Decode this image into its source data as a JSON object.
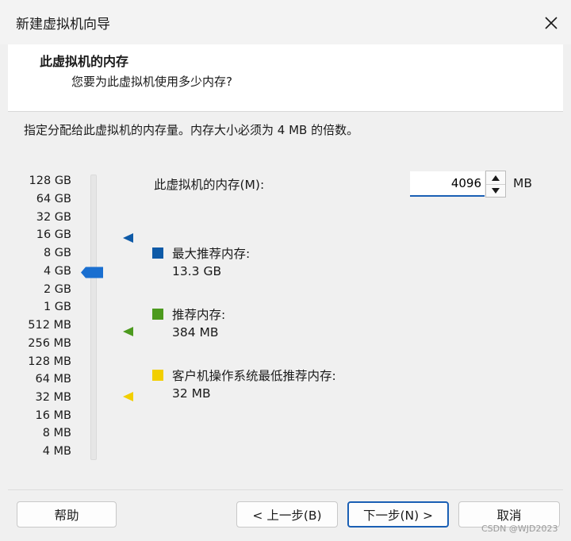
{
  "window": {
    "title": "新建虚拟机向导",
    "close_icon": "close-icon"
  },
  "header": {
    "title": "此虚拟机的内存",
    "subtitle": "您要为此虚拟机使用多少内存?"
  },
  "instruction": "指定分配给此虚拟机的内存量。内存大小必须为 4 MB 的倍数。",
  "memory_slider": {
    "ticks": [
      "128 GB",
      "64 GB",
      "32 GB",
      "16 GB",
      "8 GB",
      "4 GB",
      "2 GB",
      "1 GB",
      "512 MB",
      "256 MB",
      "128 MB",
      "64 MB",
      "32 MB",
      "16 MB",
      "8 MB",
      "4 MB"
    ],
    "selected": "4 GB",
    "thumb_color": "#1a6fd0"
  },
  "memory_field": {
    "label": "此虚拟机的内存(M):",
    "value": "4096",
    "unit": "MB"
  },
  "legend": {
    "max_recommended": {
      "label": "最大推荐内存:",
      "value": "13.3 GB",
      "color": "#0e5aa7"
    },
    "recommended": {
      "label": "推荐内存:",
      "value": "384 MB",
      "color": "#4c9a1e"
    },
    "guest_min": {
      "label": "客户机操作系统最低推荐内存:",
      "value": "32 MB",
      "color": "#f2cf00"
    }
  },
  "buttons": {
    "help": "帮助",
    "back": "< 上一步(B)",
    "next": "下一步(N) >",
    "cancel": "取消"
  },
  "watermark": "CSDN @WJD2023"
}
